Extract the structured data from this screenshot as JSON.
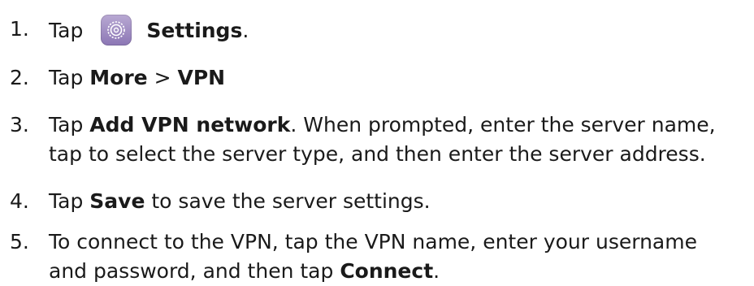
{
  "steps": [
    {
      "number": "1.",
      "segments": [
        "Tap",
        "Settings",
        "."
      ]
    },
    {
      "number": "2.",
      "segments": [
        "Tap ",
        "More",
        " > ",
        "VPN"
      ]
    },
    {
      "number": "3.",
      "segments": [
        "Tap ",
        "Add VPN network",
        ". When prompted, enter the server name,"
      ],
      "line2": "tap to select the server type, and then enter the server address."
    },
    {
      "number": "4.",
      "segments": [
        "Tap ",
        "Save",
        " to save the server settings."
      ]
    },
    {
      "number": "5.",
      "line1": "To connect to the VPN, tap the VPN name, enter your username",
      "line2_segments": [
        "and password, and then tap ",
        "Connect",
        "."
      ]
    }
  ],
  "icons": {
    "settings": "settings-gear-icon"
  },
  "colors": {
    "text": "#1a1a1a",
    "icon_top": "#b9a9d3",
    "icon_bottom": "#8b76b4"
  }
}
